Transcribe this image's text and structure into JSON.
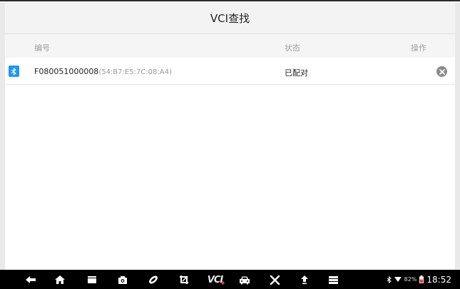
{
  "window": {
    "title": "VCI查找"
  },
  "table": {
    "headers": {
      "id": "编号",
      "status": "状态",
      "action": "操作"
    },
    "rows": [
      {
        "serial": "F080051000008",
        "mac": "(54:B7:E5:7C:08:A4)",
        "status": "已配对",
        "icon": "bluetooth-icon"
      }
    ]
  },
  "navbar": {
    "icons": [
      "back-icon",
      "home-icon",
      "recent-apps-icon",
      "camera-icon",
      "browser-icon",
      "screenshot-crop-icon",
      "vci-icon",
      "car-icon",
      "tools-icon",
      "upload-icon",
      "menu-icon"
    ],
    "vci_label": "VCI",
    "status": {
      "battery": "82%",
      "time": "18:52"
    }
  },
  "colors": {
    "accent": "#2196f3",
    "vci_alert": "#e53935",
    "battery": "#e53935"
  }
}
